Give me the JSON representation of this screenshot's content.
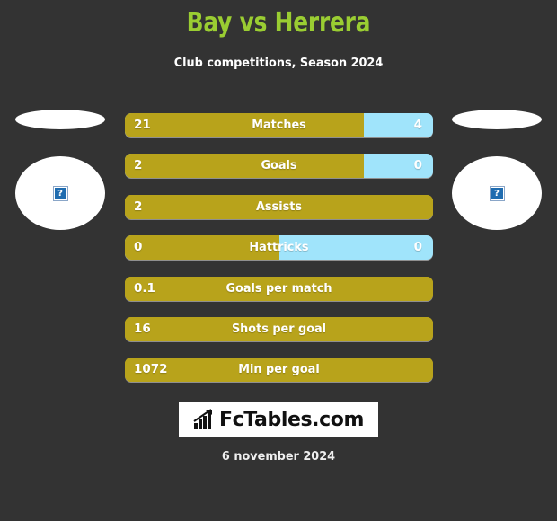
{
  "header": {
    "title": "Bay vs Herrera",
    "subtitle": "Club competitions, Season 2024"
  },
  "colors": {
    "background": "#333333",
    "title": "#9acd32",
    "home_bar": "#b8a31b",
    "away_bar": "#a0e4fb",
    "text": "#ffffff",
    "logo_box": "#ffffff"
  },
  "badges": {
    "left": {
      "icon": "broken-image-icon",
      "glyph": "?"
    },
    "right": {
      "icon": "broken-image-icon",
      "glyph": "?"
    }
  },
  "chart_data": {
    "type": "bar",
    "title": "Bay vs Herrera",
    "subtitle": "Club competitions, Season 2024",
    "xlabel": "",
    "ylabel": "",
    "grid": false,
    "legend": [
      "Bay",
      "Herrera"
    ],
    "categories": [
      "Matches",
      "Goals",
      "Assists",
      "Hattricks",
      "Goals per match",
      "Shots per goal",
      "Min per goal"
    ],
    "series": [
      {
        "name": "Bay",
        "values": [
          21,
          2,
          2,
          0,
          0.1,
          16,
          1072
        ]
      },
      {
        "name": "Herrera",
        "values": [
          4,
          0,
          null,
          0,
          null,
          null,
          null
        ]
      }
    ],
    "rows": [
      {
        "label": "Matches",
        "home": "21",
        "away": "4",
        "home_pct": 77.6,
        "show_away": true
      },
      {
        "label": "Goals",
        "home": "2",
        "away": "0",
        "home_pct": 77.6,
        "show_away": true
      },
      {
        "label": "Assists",
        "home": "2",
        "away": "",
        "home_pct": 100,
        "show_away": false
      },
      {
        "label": "Hattricks",
        "home": "0",
        "away": "0",
        "home_pct": 50,
        "show_away": true
      },
      {
        "label": "Goals per match",
        "home": "0.1",
        "away": "",
        "home_pct": 100,
        "show_away": false
      },
      {
        "label": "Shots per goal",
        "home": "16",
        "away": "",
        "home_pct": 100,
        "show_away": false
      },
      {
        "label": "Min per goal",
        "home": "1072",
        "away": "",
        "home_pct": 100,
        "show_away": false
      }
    ]
  },
  "footer": {
    "logo_text": "FcTables.com",
    "logo_icon": "bar-chart-icon",
    "date": "6 november 2024"
  }
}
